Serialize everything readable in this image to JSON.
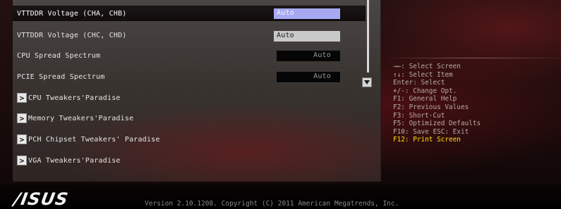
{
  "settings": [
    {
      "label": "VTTDDR Voltage (CHA, CHB)",
      "value": "Auto"
    },
    {
      "label": "VTTDDR Voltage (CHC, CHD)",
      "value": "Auto"
    },
    {
      "label": "CPU Spread Spectrum",
      "value": "Auto"
    },
    {
      "label": "PCIE Spread Spectrum",
      "value": "Auto"
    }
  ],
  "submenus": [
    {
      "label": "CPU Tweakers'Paradise"
    },
    {
      "label": "Memory Tweakers'Paradise"
    },
    {
      "label": "PCH Chipset Tweakers' Paradise"
    },
    {
      "label": "VGA Tweakers'Paradise"
    }
  ],
  "submenu_arrow": ">",
  "help": [
    "→←: Select Screen",
    "↑↓: Select Item",
    "Enter: Select",
    "+/-: Change Opt.",
    "F1: General Help",
    "F2: Previous Values",
    "F3: Short-Cut",
    "F5: Optimized Defaults",
    "F10: Save  ESC: Exit",
    "F12: Print Screen"
  ],
  "footer": {
    "logo": "/ISUS",
    "version": "Version 2.10.1208. Copyright (C) 2011 American Megatrends, Inc."
  },
  "colors": {
    "selected_value_bg": "#a6a9f2",
    "highlight_text": "#ffe014"
  },
  "icons": {
    "submenu": "chevron-right-icon",
    "scroll_down": "triangle-down-icon"
  }
}
